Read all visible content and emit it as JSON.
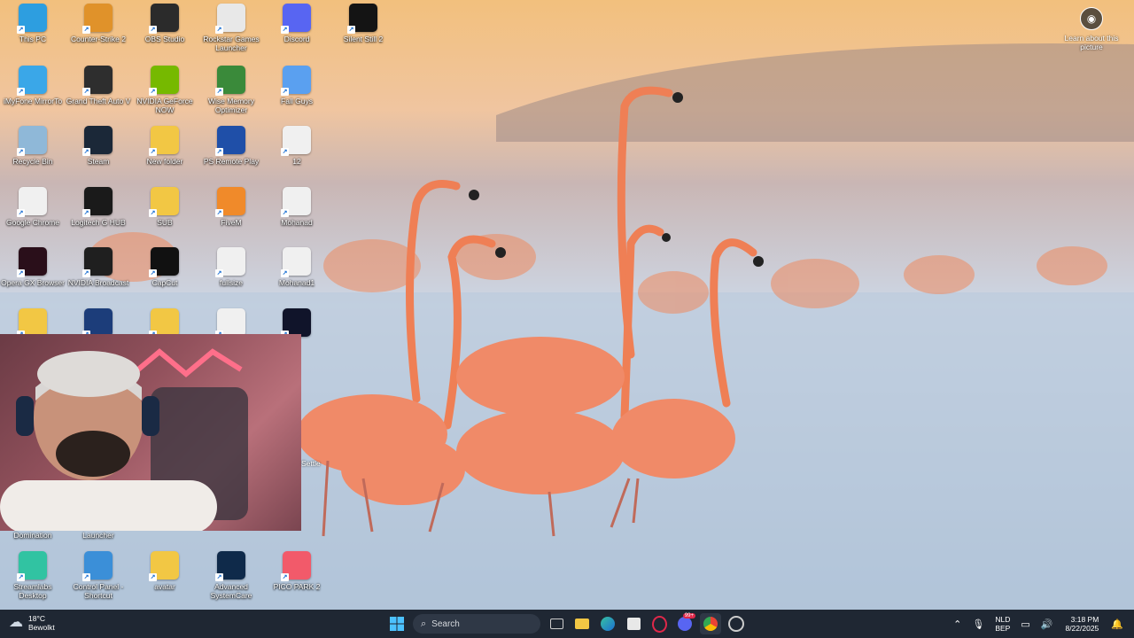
{
  "desktop_icons": [
    {
      "label": "This PC",
      "icon": "monitor-icon",
      "color": "#2d9ee0",
      "col": 0,
      "row": 0
    },
    {
      "label": "Counter-Strike 2",
      "icon": "cs2-icon",
      "color": "#e0922a",
      "col": 1,
      "row": 0
    },
    {
      "label": "OBS Studio",
      "icon": "obs-icon",
      "color": "#2b2b2b",
      "col": 2,
      "row": 0
    },
    {
      "label": "Rockstar Games Launcher",
      "icon": "file-icon",
      "color": "#e8e8e8",
      "col": 3,
      "row": 0
    },
    {
      "label": "Discord",
      "icon": "discord-icon",
      "color": "#5865f2",
      "col": 4,
      "row": 0
    },
    {
      "label": "Silent Still 2",
      "icon": "game-icon",
      "color": "#141414",
      "col": 5,
      "row": 0
    },
    {
      "label": "iMyFone MirrorTo",
      "icon": "mirror-icon",
      "color": "#3aa7e8",
      "col": 0,
      "row": 1
    },
    {
      "label": "Grand Theft Auto V",
      "icon": "gta-icon",
      "color": "#2e2e2e",
      "col": 1,
      "row": 1
    },
    {
      "label": "NVIDIA GeForce NOW",
      "icon": "nvidia-icon",
      "color": "#76b900",
      "col": 2,
      "row": 1
    },
    {
      "label": "Wise Memory Optimizer",
      "icon": "memory-icon",
      "color": "#3a8a3a",
      "col": 3,
      "row": 1
    },
    {
      "label": "Fall Guys",
      "icon": "fallguys-icon",
      "color": "#5aa0f0",
      "col": 4,
      "row": 1
    },
    {
      "label": "Recycle Bin",
      "icon": "recycle-bin-icon",
      "color": "#8fb8d8",
      "col": 0,
      "row": 2
    },
    {
      "label": "Steam",
      "icon": "steam-icon",
      "color": "#1b2838",
      "col": 1,
      "row": 2
    },
    {
      "label": "New folder",
      "icon": "folder-icon",
      "color": "#f2c744",
      "col": 2,
      "row": 2
    },
    {
      "label": "PS Remote Play",
      "icon": "ps-remote-icon",
      "color": "#1f4fa8",
      "col": 3,
      "row": 2
    },
    {
      "label": "12",
      "icon": "chrome-icon",
      "color": "#f0f0f0",
      "col": 4,
      "row": 2
    },
    {
      "label": "Google Chrome",
      "icon": "chrome-icon",
      "color": "#f0f0f0",
      "col": 0,
      "row": 3
    },
    {
      "label": "Logitech G HUB",
      "icon": "logitech-icon",
      "color": "#1a1a1a",
      "col": 1,
      "row": 3
    },
    {
      "label": "SUB",
      "icon": "folder-icon",
      "color": "#f2c744",
      "col": 2,
      "row": 3
    },
    {
      "label": "FiveM",
      "icon": "fivem-icon",
      "color": "#f08a2a",
      "col": 3,
      "row": 3
    },
    {
      "label": "Mohanad",
      "icon": "image-file-icon",
      "color": "#f0f0f0",
      "col": 4,
      "row": 3
    },
    {
      "label": "Opera GX Browser",
      "icon": "opera-icon",
      "color": "#2a0f1a",
      "col": 0,
      "row": 4
    },
    {
      "label": "NVIDIA Broadcast",
      "icon": "nvidia-broadcast-icon",
      "color": "#1f1f1f",
      "col": 1,
      "row": 4
    },
    {
      "label": "CapCut",
      "icon": "capcut-icon",
      "color": "#111111",
      "col": 2,
      "row": 4
    },
    {
      "label": "fullsize",
      "icon": "image-file-icon",
      "color": "#f0f0f0",
      "col": 3,
      "row": 4
    },
    {
      "label": "Mohanad1",
      "icon": "image-file-icon",
      "color": "#f0f0f0",
      "col": 4,
      "row": 4
    },
    {
      "label": "",
      "icon": "folder-icon",
      "color": "#f2c744",
      "col": 0,
      "row": 5
    },
    {
      "label": "",
      "icon": "rocket-league-icon",
      "color": "#1c3d7a",
      "col": 1,
      "row": 5
    },
    {
      "label": "",
      "icon": "folder-icon",
      "color": "#f2c744",
      "col": 2,
      "row": 5
    },
    {
      "label": "",
      "icon": "image-file-icon",
      "color": "#f0f0f0",
      "col": 3,
      "row": 5
    },
    {
      "label": "",
      "icon": "game-icon",
      "color": "#10142a",
      "col": 4,
      "row": 5
    }
  ],
  "desktop_icons_bottom": [
    {
      "label": "Streamlabs Desktop",
      "icon": "streamlabs-icon",
      "color": "#31c3a2"
    },
    {
      "label": "Control Panel - Shortcut",
      "icon": "control-panel-icon",
      "color": "#3b8fd8"
    },
    {
      "label": "avatar",
      "icon": "folder-icon",
      "color": "#f2c744"
    },
    {
      "label": "Advanced SystemCare",
      "icon": "systemcare-icon",
      "color": "#0f2a4a"
    },
    {
      "label": "PICO PARK 2",
      "icon": "pico-park-icon",
      "color": "#f25a6a"
    }
  ],
  "partial_labels": {
    "left": "Domination",
    "mid": "Launcher",
    "right_edge": "Settle"
  },
  "learn_about": {
    "label": "Learn about this picture"
  },
  "taskbar": {
    "weather_temp": "18°C",
    "weather_desc": "Bewolkt",
    "search_placeholder": "Search",
    "language_top": "NLD",
    "language_bottom": "BEP",
    "time": "3:18 PM",
    "date": "8/22/2025",
    "discord_badge": "99+",
    "apps": [
      "start-icon",
      "search",
      "task-view-icon",
      "file-explorer-icon",
      "edge-icon",
      "store-icon",
      "opera-gx-icon",
      "discord-icon",
      "chrome-icon",
      "obs-taskbar-icon"
    ]
  },
  "colors": {
    "taskbar_bg": "#1f2733",
    "accent": "#4cc2ff"
  }
}
